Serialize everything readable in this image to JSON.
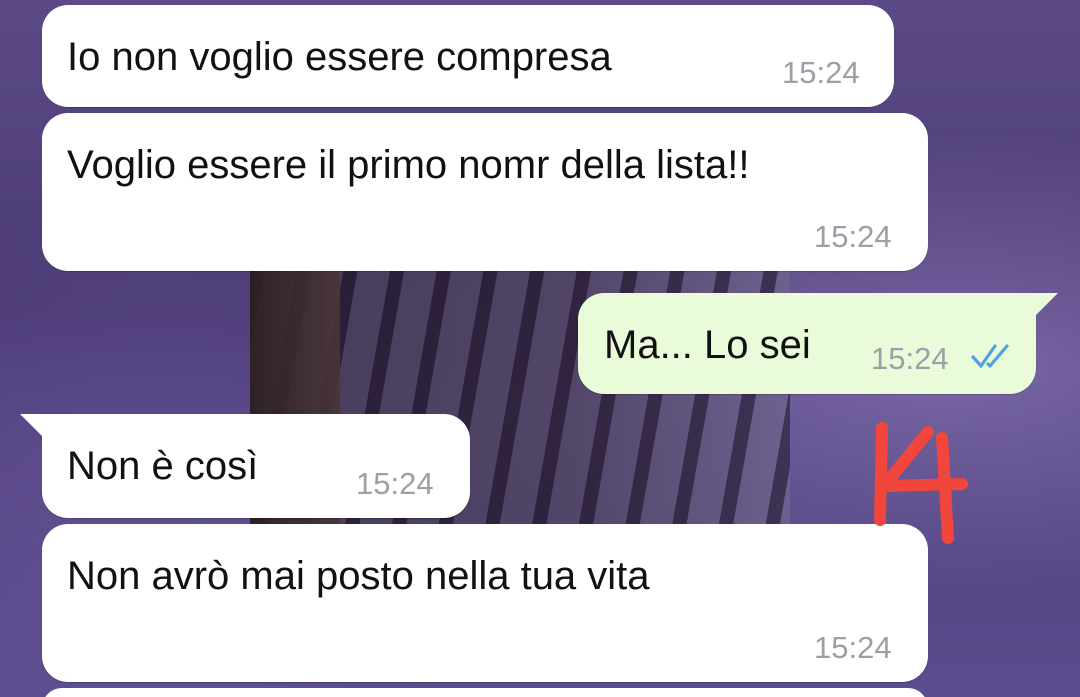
{
  "chat": {
    "messages": [
      {
        "direction": "incoming",
        "text": "Io non voglio essere compresa",
        "time": "15:24"
      },
      {
        "direction": "incoming",
        "text": "Voglio essere il primo nomr della lista!!",
        "time": "15:24"
      },
      {
        "direction": "outgoing",
        "text": "Ma... Lo sei",
        "time": "15:24",
        "status": "read"
      },
      {
        "direction": "incoming",
        "text": "Non è così",
        "time": "15:24"
      },
      {
        "direction": "incoming",
        "text": "Non avrò mai posto nella tua vita",
        "time": "15:24"
      }
    ]
  },
  "annotation": {
    "text": "K",
    "color": "#f0463c"
  },
  "colors": {
    "incoming_bubble": "#ffffff",
    "outgoing_bubble": "#e9fbd8",
    "read_ticks": "#4fa3e0",
    "time": "#9aa0a6"
  }
}
